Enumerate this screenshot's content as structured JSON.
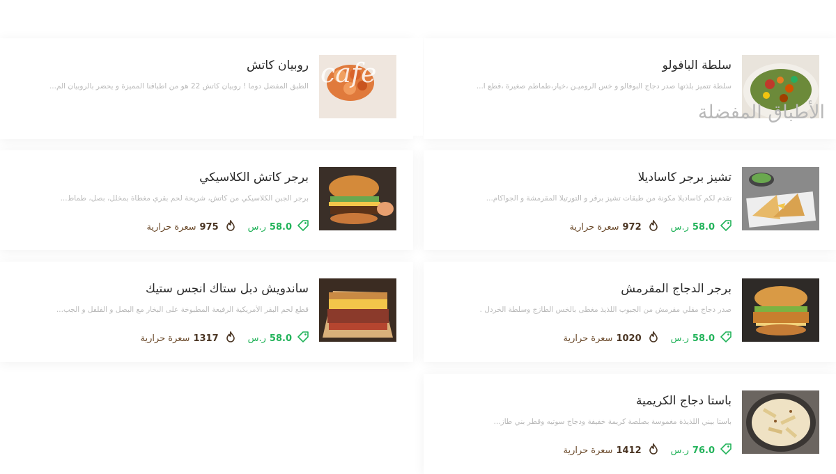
{
  "section": {
    "heading": "الأطباق المفضلة"
  },
  "watermark": "cafe",
  "currency": "ر.س",
  "calorie_unit": "سعرة حرارية",
  "colors": {
    "price": "#22b35a",
    "calories": "#6b4a2b",
    "title": "#2a2a2a",
    "description": "#b9b9b9",
    "heading": "#b8b8b8"
  },
  "items": [
    {
      "title": "سلطة البافولو",
      "description": "سلطة تتميز بلذتها صدر دجاج البوفالو و خس الروميـن ،خيار،طماطم صغيرة ،قطع ا...",
      "image": "salad-image"
    },
    {
      "title": "روبيان كاتش",
      "description": "الطبق المفضل دوما ! روبيان كاتش 22 هو من اطباقنا المميزة و يحضر بالروبيان الم...",
      "image": "shrimp-image"
    },
    {
      "title": "تشيز برجر كاساديلا",
      "description": "تقدم لكم كاساديلا مكونة من طبقات تشيز برقر و التورتيلا المقرمشة و الجواكام...",
      "price": "58.0",
      "calories": "972",
      "image": "quesadilla-image"
    },
    {
      "title": "برجر كاتش الكلاسيكي",
      "description": "برجر الجبن الكلاسيكي من كاتش، شريحة لحم بقري مغطاة بمخلل، بصل، طماط...",
      "price": "58.0",
      "calories": "975",
      "image": "burger-image"
    },
    {
      "title": "برجر الدجاج المقرمش",
      "description": "صدر دجاج مقلي مقرمش من الجبوب اللذيذ مغطى بالخس الطازج وسلطة الخردل .",
      "price": "58.0",
      "calories": "1020",
      "image": "chicken-burger-image"
    },
    {
      "title": "ساندويش دبل ستاك انجس ستيك",
      "description": "قطع لحم البقر الأمريكية الرفيعة المطبوخة على البخار مع البصل و الفلفل و الجب...",
      "price": "58.0",
      "calories": "1317",
      "image": "steak-sandwich-image"
    },
    {
      "title": "باستا دجاج الكريمية",
      "description": "باستا بيني اللذيذة مغموسة بصلصة كريمة خفيفة ودجاج سوتيه وقطر بني طاز...",
      "price": "76.0",
      "calories": "1412",
      "image": "pasta-image"
    }
  ]
}
